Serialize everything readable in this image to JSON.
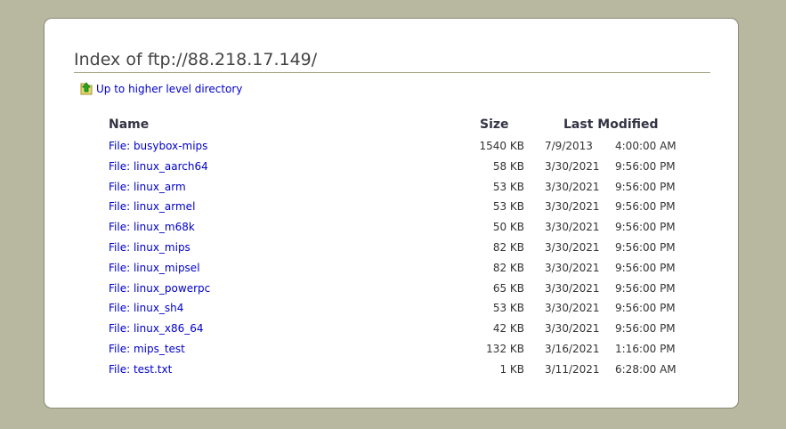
{
  "page": {
    "title": "Index of ftp://88.218.17.149/",
    "up_link_label": "Up to higher level directory"
  },
  "table": {
    "headers": {
      "name": "Name",
      "size": "Size",
      "modified": "Last Modified"
    },
    "rows": [
      {
        "name": "File: busybox-mips",
        "size": "1540 KB",
        "date": "7/9/2013",
        "time": "4:00:00 AM"
      },
      {
        "name": "File: linux_aarch64",
        "size": "58 KB",
        "date": "3/30/2021",
        "time": "9:56:00 PM"
      },
      {
        "name": "File: linux_arm",
        "size": "53 KB",
        "date": "3/30/2021",
        "time": "9:56:00 PM"
      },
      {
        "name": "File: linux_armel",
        "size": "53 KB",
        "date": "3/30/2021",
        "time": "9:56:00 PM"
      },
      {
        "name": "File: linux_m68k",
        "size": "50 KB",
        "date": "3/30/2021",
        "time": "9:56:00 PM"
      },
      {
        "name": "File: linux_mips",
        "size": "82 KB",
        "date": "3/30/2021",
        "time": "9:56:00 PM"
      },
      {
        "name": "File: linux_mipsel",
        "size": "82 KB",
        "date": "3/30/2021",
        "time": "9:56:00 PM"
      },
      {
        "name": "File: linux_powerpc",
        "size": "65 KB",
        "date": "3/30/2021",
        "time": "9:56:00 PM"
      },
      {
        "name": "File: linux_sh4",
        "size": "53 KB",
        "date": "3/30/2021",
        "time": "9:56:00 PM"
      },
      {
        "name": "File: linux_x86_64",
        "size": "42 KB",
        "date": "3/30/2021",
        "time": "9:56:00 PM"
      },
      {
        "name": "File: mips_test",
        "size": "132 KB",
        "date": "3/16/2021",
        "time": "1:16:00 PM"
      },
      {
        "name": "File: test.txt",
        "size": "1 KB",
        "date": "3/11/2021",
        "time": "6:28:00 AM"
      }
    ]
  },
  "icons": {
    "up": "folder-up-arrow-icon"
  },
  "colors": {
    "background": "#b8b8a0",
    "link": "#0000cc",
    "panel": "#ffffff"
  }
}
